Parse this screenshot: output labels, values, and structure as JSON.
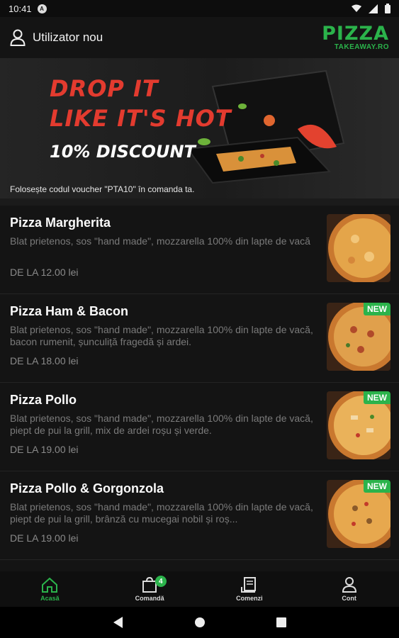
{
  "status_bar": {
    "time": "10:41",
    "notif_glyph": "A",
    "icons": [
      "wifi-icon",
      "signal-icon",
      "battery-icon"
    ]
  },
  "header": {
    "user_label": "Utilizator nou",
    "logo_main": "PIZZA",
    "logo_sub": "TAKEAWAY.RO"
  },
  "banner": {
    "line1": "DROP IT",
    "line2": "LIKE IT'S HOT",
    "discount": "10% DISCOUNT",
    "voucher_text": "Folosește codul voucher \"PTA10\" în comanda ta."
  },
  "menu": {
    "badge_label": "NEW",
    "items": [
      {
        "title": "Pizza Margherita",
        "desc": "Blat prietenos, sos \"hand made\", mozzarella 100% din lapte de vacă",
        "price": "DE LA 12.00 lei",
        "is_new": false
      },
      {
        "title": "Pizza Ham & Bacon",
        "desc": "Blat prietenos, sos \"hand made\", mozzarella 100% din lapte de vacă, bacon rumenit, șunculiță fragedă și ardei.",
        "price": "DE LA 18.00 lei",
        "is_new": true
      },
      {
        "title": "Pizza Pollo",
        "desc": "Blat prietenos, sos \"hand made\", mozzarella 100% din lapte de vacă, piept de pui la grill, mix de ardei roșu și verde.",
        "price": "DE LA 19.00 lei",
        "is_new": true
      },
      {
        "title": "Pizza Pollo & Gorgonzola",
        "desc": "Blat prietenos, sos \"hand made\", mozzarella 100% din lapte de vacă, piept de pui la grill, brânză cu mucegai nobil și roș...",
        "price": "DE LA 19.00 lei",
        "is_new": true
      }
    ]
  },
  "bottom_nav": {
    "items": [
      {
        "label": "Acasă",
        "icon": "home-icon",
        "active": true
      },
      {
        "label": "Comandă",
        "icon": "shopping-bag-icon",
        "active": false,
        "badge": "4"
      },
      {
        "label": "Comenzi",
        "icon": "orders-icon",
        "active": false
      },
      {
        "label": "Cont",
        "icon": "account-icon",
        "active": false
      }
    ]
  },
  "colors": {
    "accent": "#2bb34b",
    "banner_red": "#e33b2f",
    "background": "#141414"
  }
}
